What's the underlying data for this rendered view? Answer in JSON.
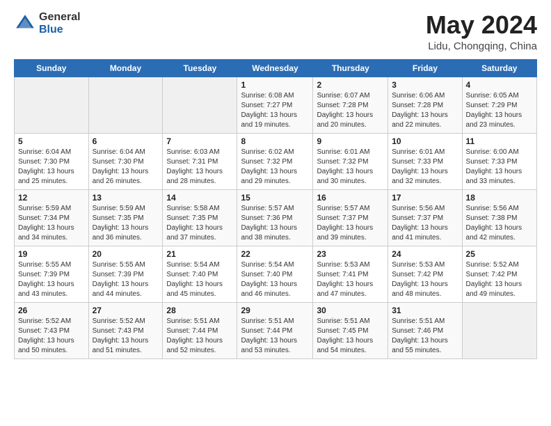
{
  "header": {
    "logo_general": "General",
    "logo_blue": "Blue",
    "title": "May 2024",
    "location": "Lidu, Chongqing, China"
  },
  "weekdays": [
    "Sunday",
    "Monday",
    "Tuesday",
    "Wednesday",
    "Thursday",
    "Friday",
    "Saturday"
  ],
  "weeks": [
    [
      {
        "day": "",
        "info": ""
      },
      {
        "day": "",
        "info": ""
      },
      {
        "day": "",
        "info": ""
      },
      {
        "day": "1",
        "info": "Sunrise: 6:08 AM\nSunset: 7:27 PM\nDaylight: 13 hours\nand 19 minutes."
      },
      {
        "day": "2",
        "info": "Sunrise: 6:07 AM\nSunset: 7:28 PM\nDaylight: 13 hours\nand 20 minutes."
      },
      {
        "day": "3",
        "info": "Sunrise: 6:06 AM\nSunset: 7:28 PM\nDaylight: 13 hours\nand 22 minutes."
      },
      {
        "day": "4",
        "info": "Sunrise: 6:05 AM\nSunset: 7:29 PM\nDaylight: 13 hours\nand 23 minutes."
      }
    ],
    [
      {
        "day": "5",
        "info": "Sunrise: 6:04 AM\nSunset: 7:30 PM\nDaylight: 13 hours\nand 25 minutes."
      },
      {
        "day": "6",
        "info": "Sunrise: 6:04 AM\nSunset: 7:30 PM\nDaylight: 13 hours\nand 26 minutes."
      },
      {
        "day": "7",
        "info": "Sunrise: 6:03 AM\nSunset: 7:31 PM\nDaylight: 13 hours\nand 28 minutes."
      },
      {
        "day": "8",
        "info": "Sunrise: 6:02 AM\nSunset: 7:32 PM\nDaylight: 13 hours\nand 29 minutes."
      },
      {
        "day": "9",
        "info": "Sunrise: 6:01 AM\nSunset: 7:32 PM\nDaylight: 13 hours\nand 30 minutes."
      },
      {
        "day": "10",
        "info": "Sunrise: 6:01 AM\nSunset: 7:33 PM\nDaylight: 13 hours\nand 32 minutes."
      },
      {
        "day": "11",
        "info": "Sunrise: 6:00 AM\nSunset: 7:33 PM\nDaylight: 13 hours\nand 33 minutes."
      }
    ],
    [
      {
        "day": "12",
        "info": "Sunrise: 5:59 AM\nSunset: 7:34 PM\nDaylight: 13 hours\nand 34 minutes."
      },
      {
        "day": "13",
        "info": "Sunrise: 5:59 AM\nSunset: 7:35 PM\nDaylight: 13 hours\nand 36 minutes."
      },
      {
        "day": "14",
        "info": "Sunrise: 5:58 AM\nSunset: 7:35 PM\nDaylight: 13 hours\nand 37 minutes."
      },
      {
        "day": "15",
        "info": "Sunrise: 5:57 AM\nSunset: 7:36 PM\nDaylight: 13 hours\nand 38 minutes."
      },
      {
        "day": "16",
        "info": "Sunrise: 5:57 AM\nSunset: 7:37 PM\nDaylight: 13 hours\nand 39 minutes."
      },
      {
        "day": "17",
        "info": "Sunrise: 5:56 AM\nSunset: 7:37 PM\nDaylight: 13 hours\nand 41 minutes."
      },
      {
        "day": "18",
        "info": "Sunrise: 5:56 AM\nSunset: 7:38 PM\nDaylight: 13 hours\nand 42 minutes."
      }
    ],
    [
      {
        "day": "19",
        "info": "Sunrise: 5:55 AM\nSunset: 7:39 PM\nDaylight: 13 hours\nand 43 minutes."
      },
      {
        "day": "20",
        "info": "Sunrise: 5:55 AM\nSunset: 7:39 PM\nDaylight: 13 hours\nand 44 minutes."
      },
      {
        "day": "21",
        "info": "Sunrise: 5:54 AM\nSunset: 7:40 PM\nDaylight: 13 hours\nand 45 minutes."
      },
      {
        "day": "22",
        "info": "Sunrise: 5:54 AM\nSunset: 7:40 PM\nDaylight: 13 hours\nand 46 minutes."
      },
      {
        "day": "23",
        "info": "Sunrise: 5:53 AM\nSunset: 7:41 PM\nDaylight: 13 hours\nand 47 minutes."
      },
      {
        "day": "24",
        "info": "Sunrise: 5:53 AM\nSunset: 7:42 PM\nDaylight: 13 hours\nand 48 minutes."
      },
      {
        "day": "25",
        "info": "Sunrise: 5:52 AM\nSunset: 7:42 PM\nDaylight: 13 hours\nand 49 minutes."
      }
    ],
    [
      {
        "day": "26",
        "info": "Sunrise: 5:52 AM\nSunset: 7:43 PM\nDaylight: 13 hours\nand 50 minutes."
      },
      {
        "day": "27",
        "info": "Sunrise: 5:52 AM\nSunset: 7:43 PM\nDaylight: 13 hours\nand 51 minutes."
      },
      {
        "day": "28",
        "info": "Sunrise: 5:51 AM\nSunset: 7:44 PM\nDaylight: 13 hours\nand 52 minutes."
      },
      {
        "day": "29",
        "info": "Sunrise: 5:51 AM\nSunset: 7:44 PM\nDaylight: 13 hours\nand 53 minutes."
      },
      {
        "day": "30",
        "info": "Sunrise: 5:51 AM\nSunset: 7:45 PM\nDaylight: 13 hours\nand 54 minutes."
      },
      {
        "day": "31",
        "info": "Sunrise: 5:51 AM\nSunset: 7:46 PM\nDaylight: 13 hours\nand 55 minutes."
      },
      {
        "day": "",
        "info": ""
      }
    ]
  ]
}
